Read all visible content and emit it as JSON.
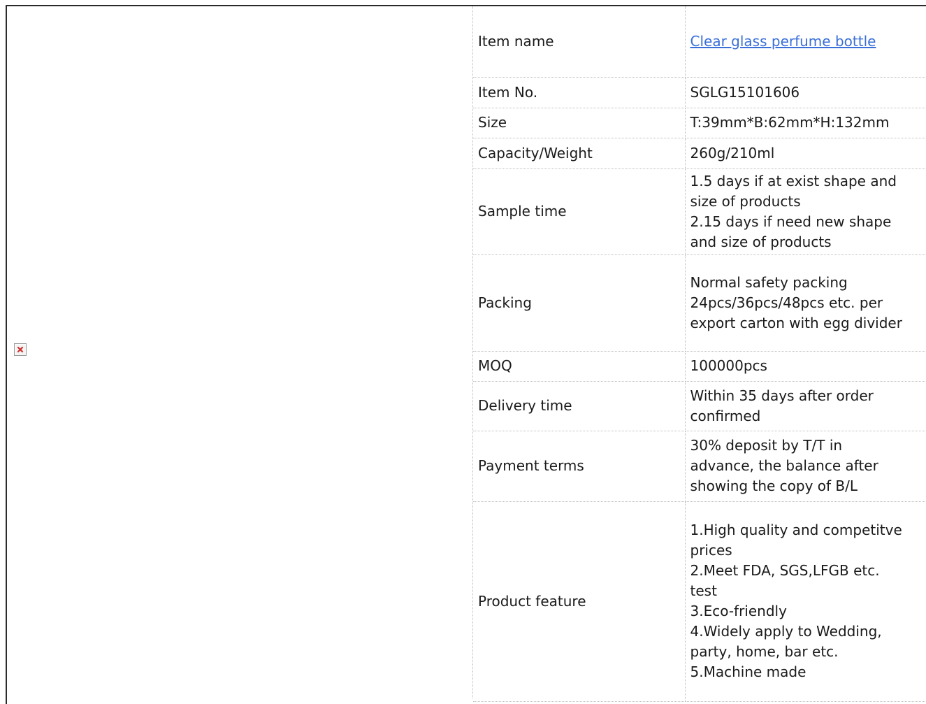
{
  "image": {
    "icon": "broken-image-icon",
    "alt": ""
  },
  "rows": [
    {
      "label": "Item name",
      "value_lines": [
        "Clear glass perfume bottle"
      ],
      "is_link": true
    },
    {
      "label": "Item No.",
      "value_lines": [
        "SGLG15101606"
      ]
    },
    {
      "label": "Size",
      "value_lines": [
        "T:39mm*B:62mm*H:132mm"
      ]
    },
    {
      "label": "Capacity/Weight",
      "value_lines": [
        "260g/210ml"
      ]
    },
    {
      "label": "Sample time",
      "value_lines": [
        "1.5 days if at exist shape and",
        "size of products",
        "2.15 days if need new shape",
        "and size of products"
      ]
    },
    {
      "label": "Packing",
      "value_lines": [
        "Normal safety packing",
        "24pcs/36pcs/48pcs etc. per",
        "export carton with egg divider"
      ]
    },
    {
      "label": "MOQ",
      "value_lines": [
        "100000pcs"
      ]
    },
    {
      "label": "Delivery time",
      "value_lines": [
        "Within 35 days after order",
        "confirmed"
      ]
    },
    {
      "label": "Payment terms",
      "value_lines": [
        "30% deposit by T/T in",
        "advance, the balance after",
        "showing the copy of B/L"
      ]
    },
    {
      "label": "Product feature",
      "value_lines": [
        "1.High quality and competitve",
        "prices",
        "2.Meet FDA, SGS,LFGB etc.",
        "test",
        "3.Eco-friendly",
        "4.Widely apply to Wedding,",
        "party, home, bar etc.",
        "5.Machine made"
      ]
    }
  ],
  "colors": {
    "link": "#3a6fd8",
    "frame_border": "#2b2b2b",
    "cell_border": "#bdbdbd",
    "broken_icon_x": "#d32f2f"
  }
}
